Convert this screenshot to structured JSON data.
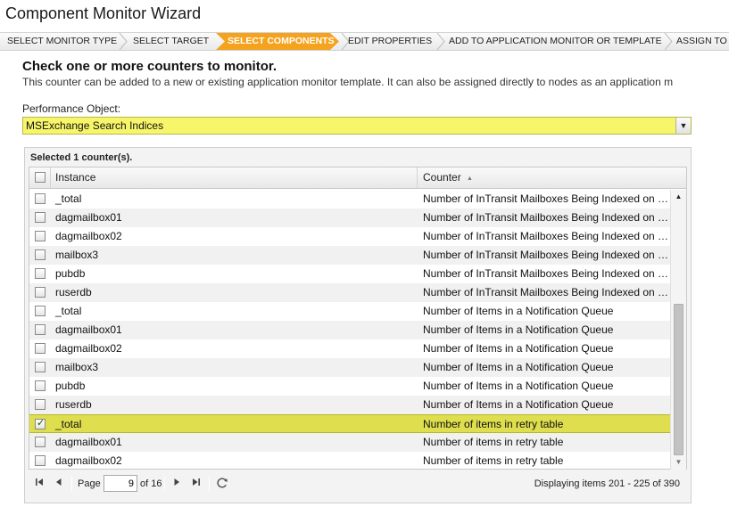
{
  "window": {
    "title": "Component Monitor Wizard"
  },
  "steps": [
    {
      "label": "SELECT MONITOR TYPE",
      "active": false
    },
    {
      "label": "SELECT TARGET",
      "active": false
    },
    {
      "label": "SELECT COMPONENTS",
      "active": true
    },
    {
      "label": "EDIT PROPERTIES",
      "active": false
    },
    {
      "label": "ADD TO APPLICATION MONITOR OR TEMPLATE",
      "active": false
    },
    {
      "label": "ASSIGN TO",
      "active": false
    }
  ],
  "main": {
    "heading": "Check one or more counters to monitor.",
    "subtext": "This counter can be added to a new or existing application monitor template. It can also be assigned directly to nodes as an application m"
  },
  "performance_object": {
    "label": "Performance Object:",
    "value": "MSExchange Search Indices"
  },
  "grid": {
    "selected_text": "Selected 1 counter(s).",
    "columns": {
      "instance": "Instance",
      "counter": "Counter"
    },
    "sort_icon": "sort-ascending-icon",
    "rows": [
      {
        "instance": "_total",
        "counter": "Number of InTransit Mailboxes Being Indexed on this Database",
        "checked": false
      },
      {
        "instance": "dagmailbox01",
        "counter": "Number of InTransit Mailboxes Being Indexed on this Database",
        "checked": false
      },
      {
        "instance": "dagmailbox02",
        "counter": "Number of InTransit Mailboxes Being Indexed on this Database",
        "checked": false
      },
      {
        "instance": "mailbox3",
        "counter": "Number of InTransit Mailboxes Being Indexed on this Database",
        "checked": false
      },
      {
        "instance": "pubdb",
        "counter": "Number of InTransit Mailboxes Being Indexed on this Database",
        "checked": false
      },
      {
        "instance": "ruserdb",
        "counter": "Number of InTransit Mailboxes Being Indexed on this Database",
        "checked": false
      },
      {
        "instance": "_total",
        "counter": "Number of Items in a Notification Queue",
        "checked": false
      },
      {
        "instance": "dagmailbox01",
        "counter": "Number of Items in a Notification Queue",
        "checked": false
      },
      {
        "instance": "dagmailbox02",
        "counter": "Number of Items in a Notification Queue",
        "checked": false
      },
      {
        "instance": "mailbox3",
        "counter": "Number of Items in a Notification Queue",
        "checked": false
      },
      {
        "instance": "pubdb",
        "counter": "Number of Items in a Notification Queue",
        "checked": false
      },
      {
        "instance": "ruserdb",
        "counter": "Number of Items in a Notification Queue",
        "checked": false
      },
      {
        "instance": "_total",
        "counter": "Number of items in retry table",
        "checked": true
      },
      {
        "instance": "dagmailbox01",
        "counter": "Number of items in retry table",
        "checked": false
      },
      {
        "instance": "dagmailbox02",
        "counter": "Number of items in retry table",
        "checked": false
      }
    ]
  },
  "pager": {
    "page_label": "Page",
    "page_value": "9",
    "of_label": "of 16",
    "display_text": "Displaying items 201 - 225 of 390"
  },
  "colors": {
    "active_step": "#f5a31f",
    "highlight": "#f7f56a",
    "selected_row": "#dede4e"
  }
}
